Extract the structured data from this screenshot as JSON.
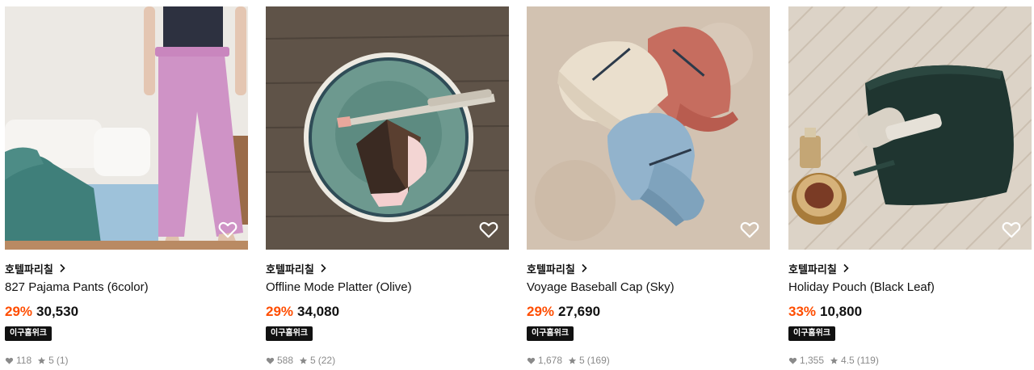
{
  "products": [
    {
      "brand": "호텔파리칠",
      "title": "827 Pajama Pants (6color)",
      "discount": "29%",
      "price": "30,530",
      "badge": "이구홈위크",
      "likes": "118",
      "rating": "5",
      "reviews": "(1)"
    },
    {
      "brand": "호텔파리칠",
      "title": "Offline Mode Platter (Olive)",
      "discount": "29%",
      "price": "34,080",
      "badge": "이구홈위크",
      "likes": "588",
      "rating": "5",
      "reviews": "(22)"
    },
    {
      "brand": "호텔파리칠",
      "title": "Voyage Baseball Cap (Sky)",
      "discount": "29%",
      "price": "27,690",
      "badge": "이구홈위크",
      "likes": "1,678",
      "rating": "5",
      "reviews": "(169)"
    },
    {
      "brand": "호텔파리칠",
      "title": "Holiday Pouch (Black Leaf)",
      "discount": "33%",
      "price": "10,800",
      "badge": "이구홈위크",
      "likes": "1,355",
      "rating": "4.5",
      "reviews": "(119)"
    }
  ],
  "colors": {
    "discount": "#ff4d00",
    "badge_bg": "#111111",
    "meta_text": "#8a8a8a"
  },
  "icons": [
    "heart-outline-icon",
    "chevron-right-icon",
    "heart-filled-icon",
    "star-icon"
  ]
}
